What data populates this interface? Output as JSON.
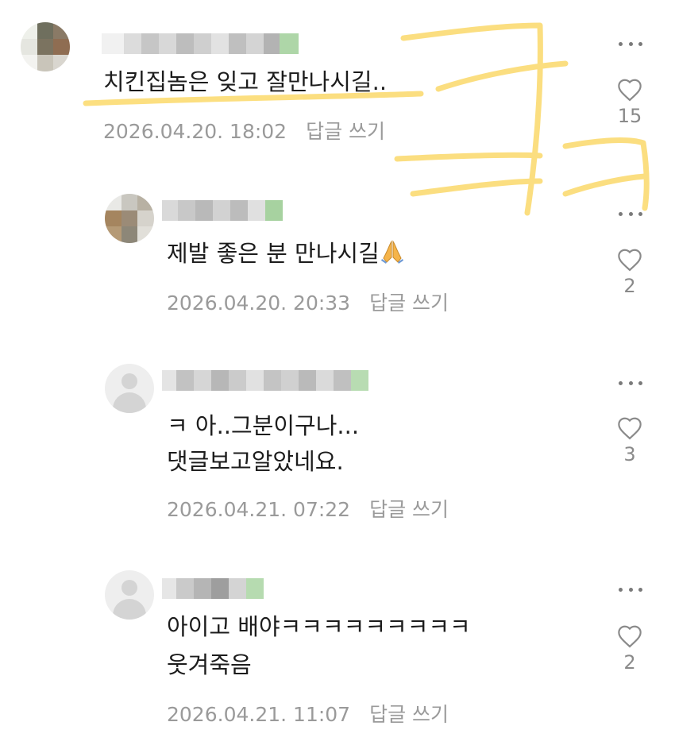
{
  "comments": [
    {
      "text": "치킨집놈은 잊고 잘만나시길..",
      "date": "2026.04.20. 18:02",
      "reply_label": "답글 쓰기",
      "likes": "15"
    },
    {
      "text": "제발 좋은 분 만나시길",
      "date": "2026.04.20. 20:33",
      "reply_label": "답글 쓰기",
      "likes": "2"
    },
    {
      "text_line1": "ㅋ 아..그분이구나...",
      "text_line2": "댓글보고알았네요.",
      "date": "2026.04.21. 07:22",
      "reply_label": "답글 쓰기",
      "likes": "3"
    },
    {
      "text_line1": "아이고 배야ㅋㅋㅋㅋㅋㅋㅋㅋㅋ",
      "text_line2": "웃겨죽음",
      "date": "2026.04.21. 11:07",
      "reply_label": "답글 쓰기",
      "likes": "2"
    }
  ],
  "icons": {
    "like": "heart-outline-icon",
    "more": "more-dots-icon",
    "emoji": "folded-hands-emoji"
  },
  "colors": {
    "highlight": "#fbd96a",
    "meta_text": "#9a9a9a",
    "body_text": "#1c1c1c"
  }
}
